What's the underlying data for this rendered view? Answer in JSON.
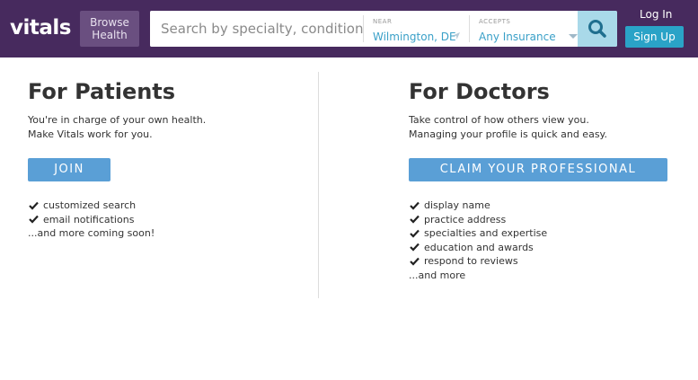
{
  "header": {
    "logo": "vitals",
    "browse_line1": "Browse",
    "browse_line2": "Health",
    "search_placeholder": "Search by specialty, condition, to",
    "near_label": "NEAR",
    "near_value": "Wilmington, DE",
    "accepts_label": "ACCEPTS",
    "accepts_value": "Any Insurance",
    "login": "Log In",
    "signup": "Sign Up",
    "brand_color": "#472a5e",
    "accent_color": "#2aa3c7"
  },
  "patients": {
    "heading": "For Patients",
    "desc_line1": "You're in charge of your own health.",
    "desc_line2": "Make Vitals work for you.",
    "cta": "JOIN",
    "features": [
      "customized search",
      "email notifications"
    ],
    "more": "...and more coming soon!"
  },
  "doctors": {
    "heading": "For Doctors",
    "desc_line1": "Take control of how others view you.",
    "desc_line2": "Managing your profile is quick and easy.",
    "cta": "CLAIM YOUR PROFESSIONAL",
    "features": [
      "display name",
      "practice address",
      "specialties and expertise",
      "education and awards",
      "respond to reviews"
    ],
    "more": "...and more"
  }
}
